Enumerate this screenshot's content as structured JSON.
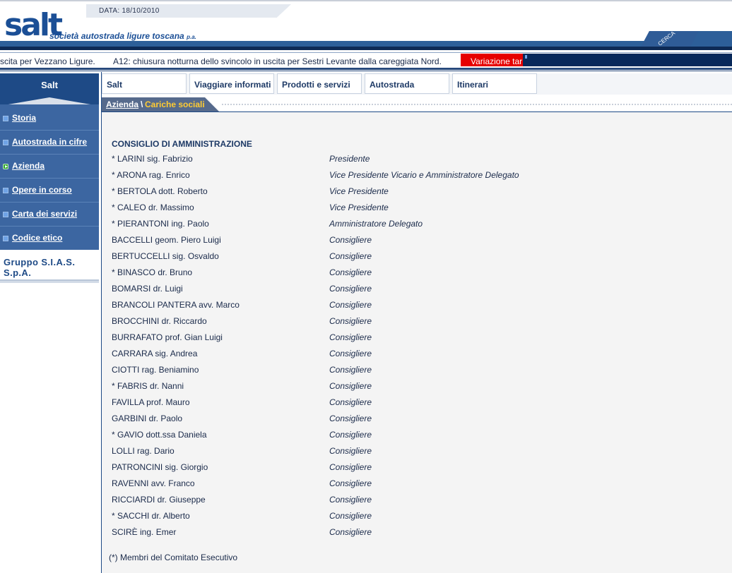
{
  "header": {
    "date_label": "DATA: 18/10/2010",
    "logo_text": "salt",
    "logo_tagline": "società autostrada ligure toscana",
    "logo_suffix": "p.a.",
    "search_label": "CERCA"
  },
  "ticker": {
    "msg1": "scita per Vezzano Ligure.",
    "msg2": "A12: chiusura notturna dello svincolo in uscita per Sestri Levante dalla careggiata Nord.",
    "alert": "Variazione tar"
  },
  "sidebar": {
    "title": "Salt",
    "items": [
      {
        "label": "Storia",
        "active": false
      },
      {
        "label": "Autostrada in cifre",
        "active": false
      },
      {
        "label": "Azienda",
        "active": true
      },
      {
        "label": "Opere in corso",
        "active": false
      },
      {
        "label": "Carta dei servizi",
        "active": false
      },
      {
        "label": "Codice etico",
        "active": false
      }
    ],
    "group_label": "Gruppo S.I.A.S. S.p.A."
  },
  "tabs": [
    {
      "label": "Salt"
    },
    {
      "label": "Viaggiare informati"
    },
    {
      "label": "Prodotti e servizi"
    },
    {
      "label": "Autostrada"
    },
    {
      "label": "Itinerari"
    }
  ],
  "breadcrumb": {
    "parent": "Azienda",
    "separator": "\\",
    "current": "Cariche sociali"
  },
  "content": {
    "section_title": "CONSIGLIO DI AMMINISTRAZIONE",
    "members": [
      {
        "name": "* LARINI sig. Fabrizio",
        "role": "Presidente"
      },
      {
        "name": "* ARONA rag. Enrico",
        "role": "Vice Presidente Vicario e Amministratore Delegato"
      },
      {
        "name": "* BERTOLA dott. Roberto",
        "role": "Vice Presidente"
      },
      {
        "name": "* CALEO dr. Massimo",
        "role": "Vice Presidente"
      },
      {
        "name": "* PIERANTONI ing. Paolo",
        "role": "Amministratore Delegato"
      },
      {
        "name": "BACCELLI geom. Piero Luigi",
        "role": "Consigliere"
      },
      {
        "name": "BERTUCCELLI sig. Osvaldo",
        "role": "Consigliere"
      },
      {
        "name": "* BINASCO dr. Bruno",
        "role": "Consigliere"
      },
      {
        "name": "BOMARSI dr. Luigi",
        "role": "Consigliere"
      },
      {
        "name": "BRANCOLI PANTERA avv. Marco",
        "role": "Consigliere"
      },
      {
        "name": "BROCCHINI dr. Riccardo",
        "role": "Consigliere"
      },
      {
        "name": "BURRAFATO prof. Gian Luigi",
        "role": "Consigliere"
      },
      {
        "name": "CARRARA sig. Andrea",
        "role": "Consigliere"
      },
      {
        "name": "CIOTTI rag. Beniamino",
        "role": "Consigliere"
      },
      {
        "name": "* FABRIS dr. Nanni",
        "role": "Consigliere"
      },
      {
        "name": "FAVILLA prof. Mauro",
        "role": "Consigliere"
      },
      {
        "name": "GARBINI dr. Paolo",
        "role": "Consigliere"
      },
      {
        "name": "* GAVIO dott.ssa Daniela",
        "role": "Consigliere"
      },
      {
        "name": "LOLLI rag. Dario",
        "role": "Consigliere"
      },
      {
        "name": "PATRONCINI sig. Giorgio",
        "role": "Consigliere"
      },
      {
        "name": "RAVENNI avv. Franco",
        "role": "Consigliere"
      },
      {
        "name": "RICCIARDI dr. Giuseppe",
        "role": "Consigliere"
      },
      {
        "name": "* SACCHI dr. Alberto",
        "role": "Consigliere"
      },
      {
        "name": "SCIRÈ ing. Emer",
        "role": "Consigliere"
      }
    ],
    "footnote": "(*) Membri del Comitato Esecutivo"
  }
}
